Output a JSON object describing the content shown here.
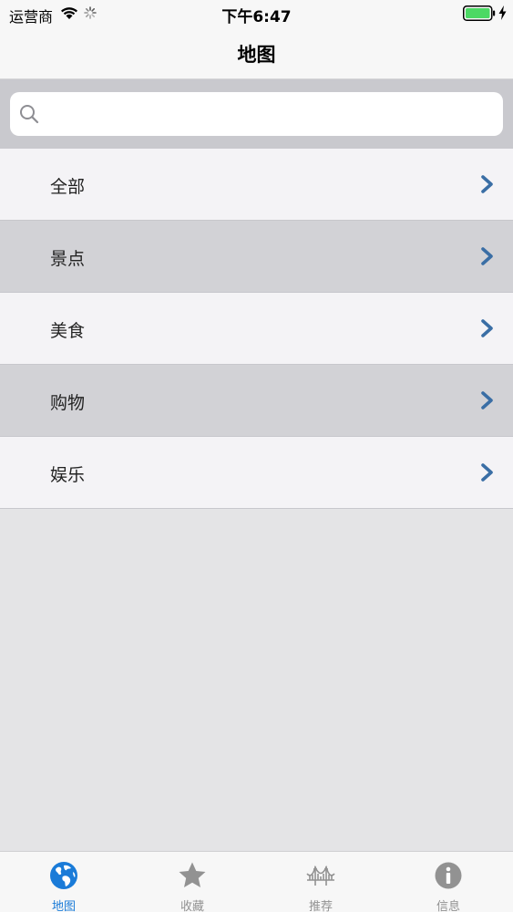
{
  "status_bar": {
    "carrier": "运营商",
    "time": "下午6:47"
  },
  "nav": {
    "title": "地图"
  },
  "search": {
    "placeholder": "",
    "value": ""
  },
  "list": {
    "items": [
      {
        "label": "全部"
      },
      {
        "label": "景点"
      },
      {
        "label": "美食"
      },
      {
        "label": "购物"
      },
      {
        "label": "娱乐"
      }
    ]
  },
  "tab_bar": {
    "tabs": [
      {
        "label": "地图",
        "icon": "globe-icon",
        "active": true
      },
      {
        "label": "收藏",
        "icon": "star-icon",
        "active": false
      },
      {
        "label": "推荐",
        "icon": "bridge-icon",
        "active": false
      },
      {
        "label": "信息",
        "icon": "info-icon",
        "active": false
      }
    ]
  },
  "colors": {
    "accent": "#1a7bd8",
    "chevron": "#3a6ea5",
    "battery": "#4cd964",
    "inactive_tab": "#929292"
  }
}
